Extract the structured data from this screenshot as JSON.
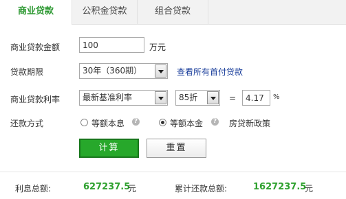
{
  "tabs": [
    {
      "label": "商业贷款",
      "active": true
    },
    {
      "label": "公积金贷款",
      "active": false
    },
    {
      "label": "组合贷款",
      "active": false
    }
  ],
  "form": {
    "amount": {
      "label": "商业贷款金额",
      "value": "100",
      "unit": "万元"
    },
    "term": {
      "label": "贷款期限",
      "selected": "30年（360期）",
      "link": "查看所有首付贷款"
    },
    "rate": {
      "label": "商业贷款利率",
      "type_selected": "最新基准利率",
      "discount_selected": "85折",
      "equals": "=",
      "value": "4.17",
      "unit": "%"
    },
    "repayment": {
      "label": "还款方式",
      "options": [
        {
          "label": "等额本息",
          "checked": false
        },
        {
          "label": "等额本金",
          "checked": true
        }
      ],
      "policy_link": "房贷新政策"
    }
  },
  "buttons": {
    "calculate": "计算",
    "reset": "重置"
  },
  "results": {
    "interest_label": "利息总额:",
    "interest_value": "627237.5",
    "interest_unit": "元",
    "total_label": "累计还款总额:",
    "total_value": "1627237.5",
    "total_unit": "元"
  },
  "colors": {
    "accent": "#27a82b",
    "link": "#1a3e9b",
    "result": "#2fa12f"
  },
  "icons": {
    "help": "question-circle-icon",
    "dropdown": "dropdown-arrow-icon"
  }
}
